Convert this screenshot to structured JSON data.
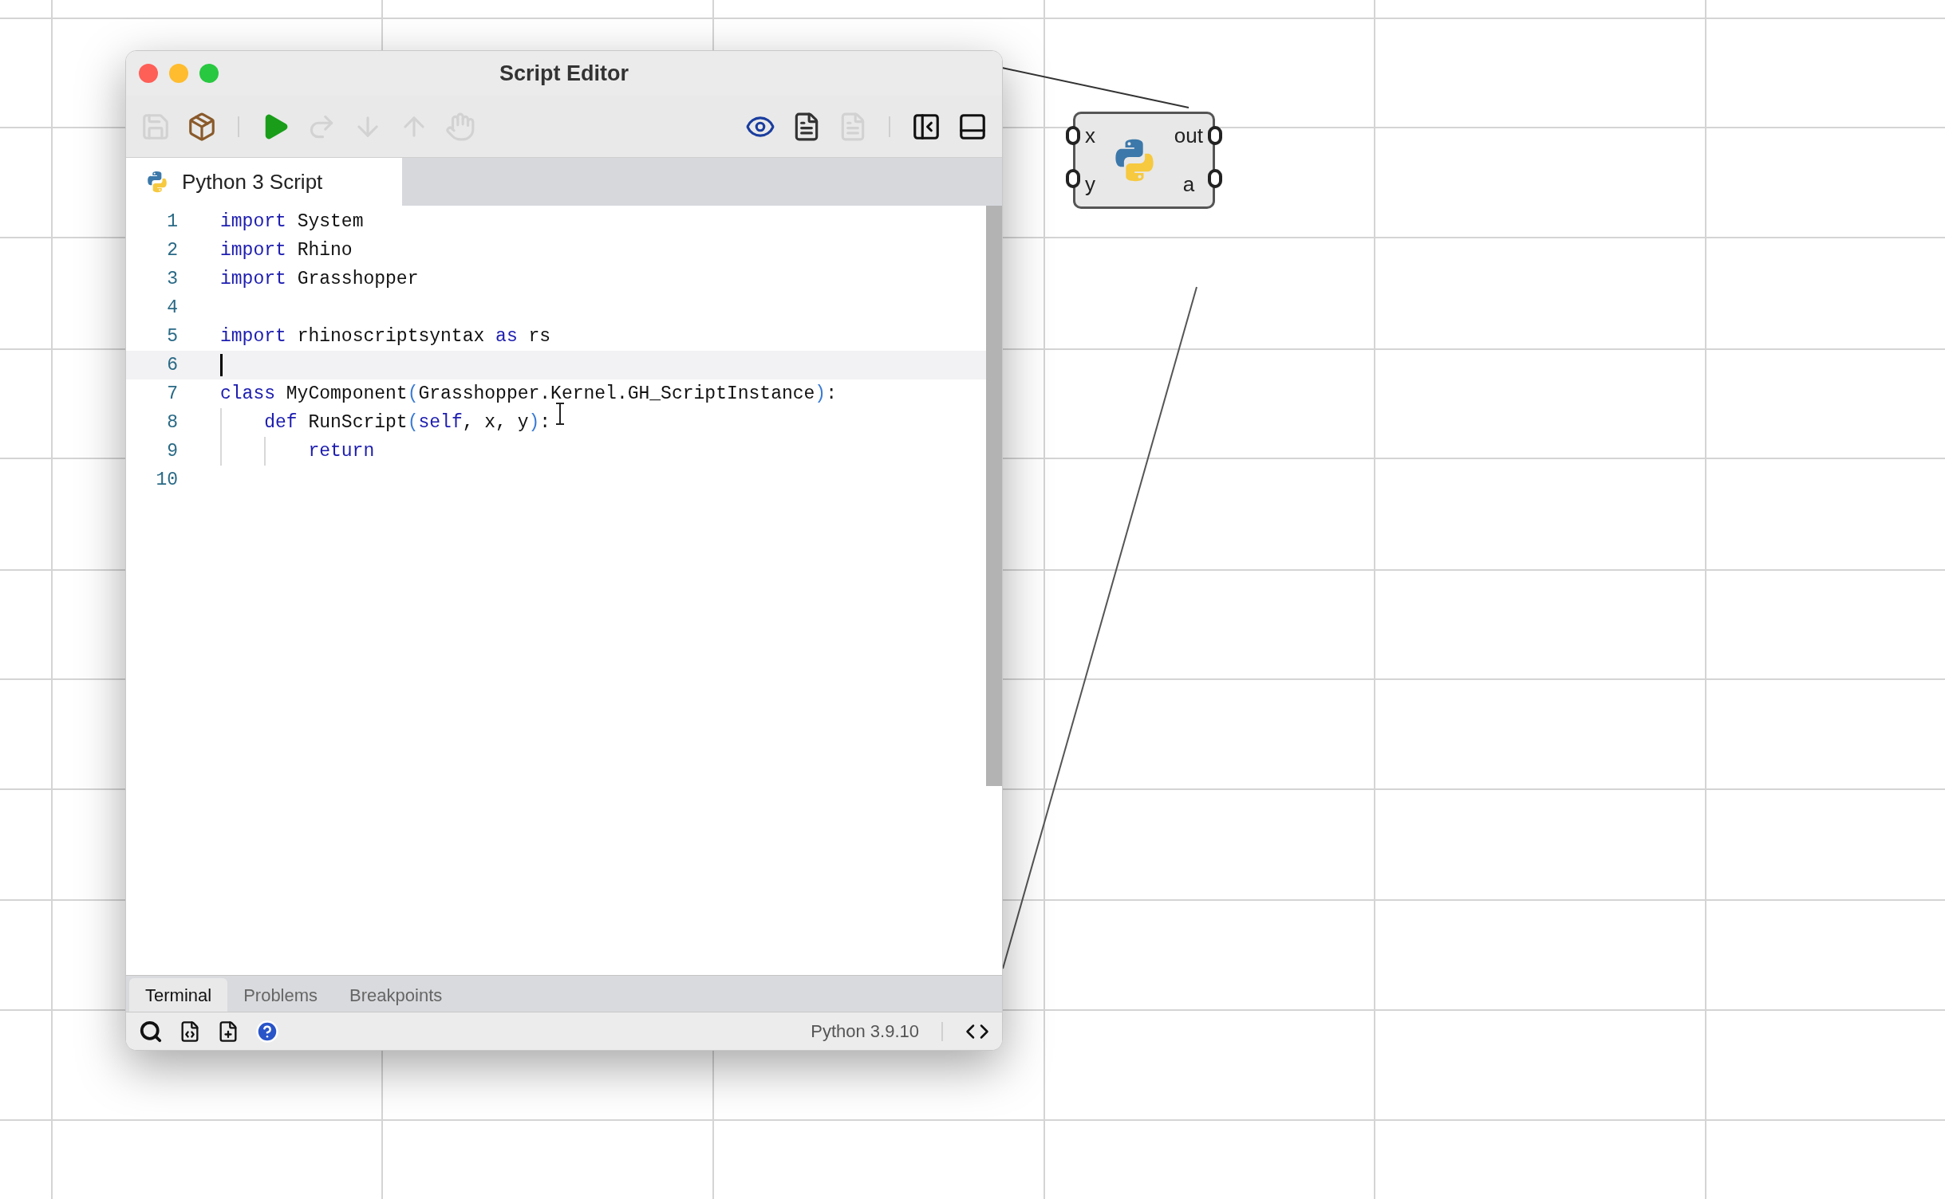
{
  "window": {
    "title": "Script Editor"
  },
  "toolbar": [
    {
      "kind": "save",
      "disabled": true
    },
    {
      "kind": "package",
      "disabled": false
    },
    {
      "kind": "separator"
    },
    {
      "kind": "run",
      "disabled": false
    },
    {
      "kind": "step-over",
      "disabled": true
    },
    {
      "kind": "step-into",
      "disabled": true
    },
    {
      "kind": "step-out",
      "disabled": true
    },
    {
      "kind": "stop",
      "disabled": true
    },
    {
      "kind": "spacer"
    },
    {
      "kind": "watch",
      "disabled": false
    },
    {
      "kind": "swap",
      "disabled": false
    },
    {
      "kind": "document",
      "disabled": true
    },
    {
      "kind": "separator"
    },
    {
      "kind": "panel-left",
      "disabled": false
    },
    {
      "kind": "panel-bottom",
      "disabled": false
    }
  ],
  "editor_tabs": [
    {
      "label": "Python 3 Script",
      "selected": true
    }
  ],
  "code_lines": [
    {
      "number": "1",
      "current": false,
      "tokens": [
        {
          "kind": "keyword",
          "text": "import"
        },
        {
          "kind": "name",
          "text": " System"
        }
      ]
    },
    {
      "number": "2",
      "current": false,
      "tokens": [
        {
          "kind": "keyword",
          "text": "import"
        },
        {
          "kind": "name",
          "text": " Rhino"
        }
      ]
    },
    {
      "number": "3",
      "current": false,
      "tokens": [
        {
          "kind": "keyword",
          "text": "import"
        },
        {
          "kind": "name",
          "text": " Grasshopper"
        }
      ]
    },
    {
      "number": "4",
      "current": false
    },
    {
      "number": "5",
      "current": false,
      "tokens": [
        {
          "kind": "keyword",
          "text": "import"
        },
        {
          "kind": "name",
          "text": " rhinoscriptsyntax "
        },
        {
          "kind": "keyword",
          "text": "as"
        },
        {
          "kind": "name",
          "text": " rs"
        }
      ]
    },
    {
      "number": "6",
      "current": true
    },
    {
      "number": "7",
      "current": false,
      "tokens": [
        {
          "kind": "keyword",
          "text": "class"
        },
        {
          "kind": "name",
          "text": " MyComponent"
        },
        {
          "kind": "punct",
          "text": "("
        },
        {
          "kind": "name",
          "text": "Grasshopper.Kernel.GH_ScriptInstance"
        },
        {
          "kind": "punct",
          "text": ")"
        },
        {
          "kind": "name",
          "text": ":"
        }
      ]
    },
    {
      "number": "8",
      "current": false,
      "tokens": [
        {
          "kind": "keyword",
          "text": "    def"
        },
        {
          "kind": "name",
          "text": " RunScript"
        },
        {
          "kind": "punct",
          "text": "("
        },
        {
          "kind": "keyword",
          "text": "self"
        },
        {
          "kind": "name",
          "text": ", x, y"
        },
        {
          "kind": "punct",
          "text": ")"
        },
        {
          "kind": "name",
          "text": ":"
        }
      ]
    },
    {
      "number": "9",
      "current": false,
      "tokens": [
        {
          "kind": "keyword",
          "text": "        return"
        }
      ]
    },
    {
      "number": "10",
      "current": false
    }
  ],
  "panel_tabs": [
    {
      "label": "Terminal",
      "selected": true
    },
    {
      "label": "Problems",
      "selected": false
    },
    {
      "label": "Breakpoints",
      "selected": false
    }
  ],
  "status_bar": {
    "runtime": "Python 3.9.10"
  },
  "component": {
    "inputs": [
      "x",
      "y"
    ],
    "outputs": [
      "out",
      "a"
    ]
  }
}
